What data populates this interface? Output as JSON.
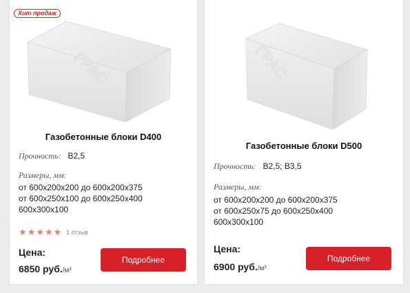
{
  "products": [
    {
      "badge": "Хит продаж",
      "image_text": "ГРАС",
      "title": "Газобетонные блоки D400",
      "strength_label": "Прочность:",
      "strength_value": "B2,5",
      "sizes_label": "Размеры, мм:",
      "sizes": [
        "от 600x200x200 до 600x200x375",
        "от 600x250x100 до 600x250x400",
        "600x300x100"
      ],
      "rating": 5,
      "reviews": "1 отзыв",
      "price_label": "Цена:",
      "price": "6850 руб.",
      "unit": "/м³",
      "button": "Подробнее"
    },
    {
      "image_text": "ГРАС",
      "title": "Газобетонные блоки D500",
      "strength_label": "Прочность:",
      "strength_value": "B2,5; B3,5",
      "sizes_label": "Размеры, мм:",
      "sizes": [
        "от 600x200x200 до 600x200x375",
        "от 600x250x75 до 600x250x400",
        "600x300x100"
      ],
      "price_label": "Цена:",
      "price": "6900 руб.",
      "unit": "/м³",
      "button": "Подробнее"
    }
  ],
  "colors": {
    "accent": "#d72027",
    "star": "#e2826b"
  }
}
